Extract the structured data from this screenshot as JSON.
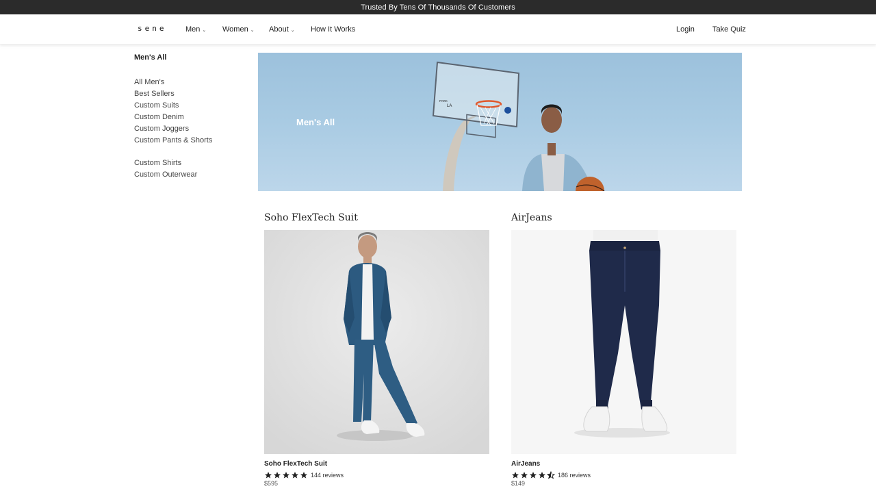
{
  "announcement": "Trusted By Tens Of Thousands Of Customers",
  "nav": {
    "logo": "sene",
    "items": [
      {
        "label": "Men"
      },
      {
        "label": "Women"
      },
      {
        "label": "About"
      },
      {
        "label": "How It Works"
      }
    ],
    "login": "Login",
    "quiz": "Take Quiz",
    "chevron_icon": "chevron-down-icon"
  },
  "sidebar": {
    "title": "Men's All",
    "group1": [
      "All Men's",
      "Best Sellers",
      "Custom Suits",
      "Custom Denim",
      "Custom Joggers",
      "Custom Pants & Shorts"
    ],
    "group2": [
      "Custom Shirts",
      "Custom Outerwear"
    ]
  },
  "hero": {
    "title": "Men's All"
  },
  "products": [
    {
      "heading": "Soho FlexTech Suit",
      "name": "Soho FlexTech Suit",
      "rating": 5,
      "reviews": "144 reviews",
      "price": "$595"
    },
    {
      "heading": "AirJeans",
      "name": "AirJeans",
      "rating": 4.5,
      "reviews": "186 reviews",
      "price": "$149"
    }
  ],
  "colors": {
    "announcement_bg": "#2b2b2b",
    "sky": "#a9cbe3",
    "star": "#222222"
  }
}
